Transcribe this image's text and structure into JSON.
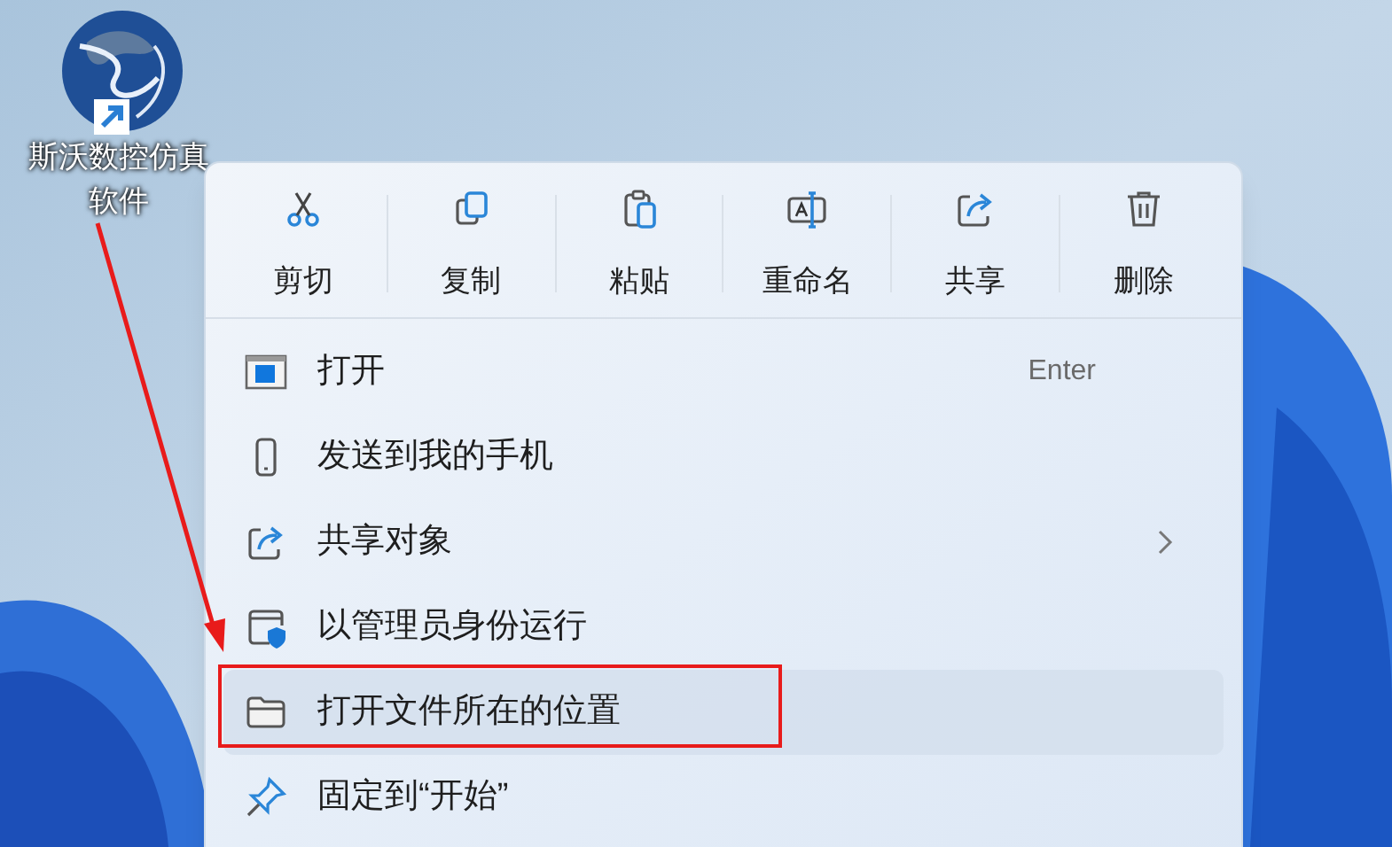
{
  "desktop_icon": {
    "label": "斯沃数控仿真软件"
  },
  "context_menu": {
    "toolbar": [
      {
        "kind": "cut",
        "label": "剪切"
      },
      {
        "kind": "copy",
        "label": "复制"
      },
      {
        "kind": "paste",
        "label": "粘贴"
      },
      {
        "kind": "rename",
        "label": "重命名"
      },
      {
        "kind": "share",
        "label": "共享"
      },
      {
        "kind": "delete",
        "label": "删除"
      }
    ],
    "items": [
      {
        "kind": "open",
        "label": "打开",
        "shortcut": "Enter",
        "has_submenu": false,
        "selected": false
      },
      {
        "kind": "phone",
        "label": "发送到我的手机",
        "has_submenu": false,
        "selected": false
      },
      {
        "kind": "share",
        "label": "共享对象",
        "has_submenu": true,
        "selected": false
      },
      {
        "kind": "admin",
        "label": "以管理员身份运行",
        "has_submenu": false,
        "selected": false
      },
      {
        "kind": "folder",
        "label": "打开文件所在的位置",
        "has_submenu": false,
        "selected": true
      },
      {
        "kind": "pin",
        "label": "固定到“开始”",
        "has_submenu": false,
        "selected": false
      }
    ]
  }
}
